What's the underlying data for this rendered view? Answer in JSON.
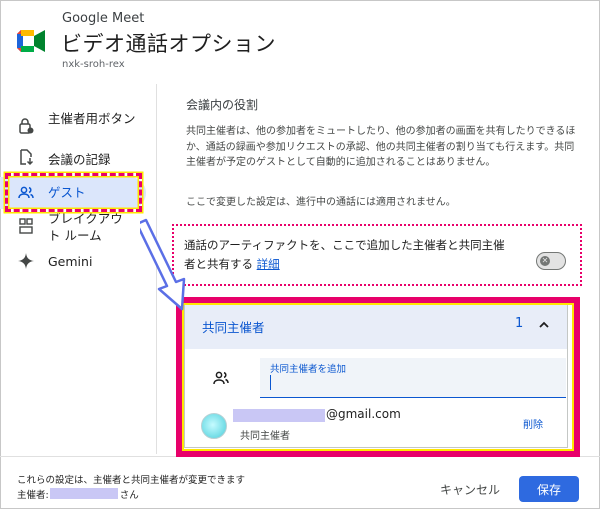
{
  "header": {
    "app_name": "Google Meet",
    "title": "ビデオ通話オプション",
    "meeting_code": "nxk-sroh-rex"
  },
  "sidebar": {
    "items": [
      {
        "label": "主催者用ボタン",
        "icon": "lock-person-icon"
      },
      {
        "label": "会議の記録",
        "icon": "file-save-icon"
      },
      {
        "label": "ゲスト",
        "icon": "people-icon"
      },
      {
        "label": "ブレイクアウト ルーム",
        "icon": "breakout-room-icon"
      },
      {
        "label": "Gemini",
        "icon": "gemini-sparkle-icon"
      }
    ]
  },
  "main": {
    "section_title": "会議内の役割",
    "description": "共同主催者は、他の参加者をミュートしたり、他の参加者の画面を共有したりできるほか、通話の録画や参加リクエストの承認、他の共同主催者の割り当ても行えます。共同主催者が予定のゲストとして自動的に追加されることはありません。",
    "note": "ここで変更した設定は、進行中の通話には適用されません。",
    "share_artifacts": {
      "text": "通話のアーティファクトを、ここで追加した主催者と共同主催者と共有する",
      "link": "詳細",
      "toggle_on": false
    },
    "cohost_panel": {
      "title": "共同主催者",
      "count": "1",
      "add_label": "共同主催者を追加",
      "add_value": "",
      "cohosts": [
        {
          "email_domain": "@gmail.com",
          "role": "共同主催者",
          "remove_label": "削除"
        }
      ]
    }
  },
  "footer": {
    "info": "これらの設定は、主催者と共同主催者が変更できます",
    "host_prefix": "主催者:",
    "host_suffix": "さん",
    "cancel_label": "キャンセル",
    "save_label": "保存"
  },
  "colors": {
    "accent": "#0b57d0",
    "save_button": "#2e6ae0",
    "active_nav_bg": "#dbe6fb",
    "annotation_red": "#e8006a",
    "annotation_yellow": "#ffe600",
    "annotation_arrow": "#5b6fe6",
    "redaction": "#c9c7f5"
  }
}
